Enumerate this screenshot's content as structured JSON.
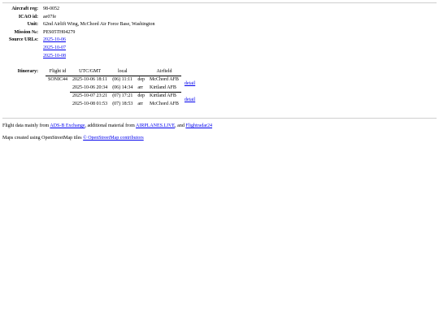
{
  "aircraft": {
    "reg_label": "Aircraft reg:",
    "reg": "98-0052",
    "icao_label": "ICAO id:",
    "icao": "ae07fe",
    "unit_label": "Unit:",
    "unit": "62nd Airlift Wing, McChord Air Force Base, Washington",
    "mission_label": "Mission №:",
    "mission": "PES05TH04279",
    "sources_label": "Source URLs:",
    "sources": [
      "2025-10-06",
      "2025-10-07",
      "2025-10-08"
    ]
  },
  "itinerary": {
    "label": "Itinerary:",
    "headers": [
      "Flight id",
      "UTC/GMT",
      "local",
      "",
      "Airfield"
    ],
    "flight_id": "SONIC44",
    "rows": [
      {
        "utc": "2025-10-06 18:11",
        "local": "(06) 11:11",
        "dir": "dep",
        "airfield": "McChord AFB"
      },
      {
        "utc": "2025-10-06 20:34",
        "local": "(06) 14:34",
        "dir": "arr",
        "airfield": "Kirtland AFB"
      },
      {
        "utc": "2025-10-07 23:21",
        "local": "(07) 17:21",
        "dir": "dep",
        "airfield": "Kirtland AFB"
      },
      {
        "utc": "2025-10-08 01:53",
        "local": "(07) 18:53",
        "dir": "arr",
        "airfield": "McChord AFB"
      }
    ],
    "detail_label": "detail"
  },
  "footer": {
    "line1_prefix": "Flight data mainly from ",
    "adsb_link": "ADS-B Exchange",
    "line1_mid": ", additional material from ",
    "airplanes_link": "AIRPLANES.LIVE",
    "line1_and": ", and ",
    "fr24_link": "Flightradar24",
    "line2_prefix": "Maps created using OpenStreetMap tiles ",
    "osm_link": "© OpenStreetMap contributors"
  }
}
